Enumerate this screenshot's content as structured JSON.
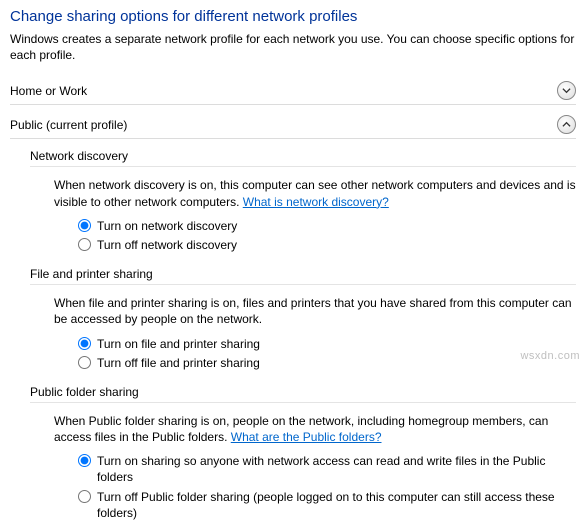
{
  "title": "Change sharing options for different network profiles",
  "description": "Windows creates a separate network profile for each network you use. You can choose specific options for each profile.",
  "sections": {
    "home_or_work": {
      "label": "Home or Work"
    },
    "public": {
      "label": "Public (current profile)"
    }
  },
  "network_discovery": {
    "heading": "Network discovery",
    "text": "When network discovery is on, this computer can see other network computers and devices and is visible to other network computers. ",
    "link": "What is network discovery?",
    "radio_on": "Turn on network discovery",
    "radio_off": "Turn off network discovery"
  },
  "file_printer": {
    "heading": "File and printer sharing",
    "text": "When file and printer sharing is on, files and printers that you have shared from this computer can be accessed by people on the network.",
    "radio_on": "Turn on file and printer sharing",
    "radio_off": "Turn off file and printer sharing"
  },
  "public_folder": {
    "heading": "Public folder sharing",
    "text": "When Public folder sharing is on, people on the network, including homegroup members, can access files in the Public folders. ",
    "link": "What are the Public folders?",
    "radio_on": "Turn on sharing so anyone with network access can read and write files in the Public folders",
    "radio_off": "Turn off Public folder sharing (people logged on to this computer can still access these folders)"
  },
  "watermark": "wsxdn.com"
}
